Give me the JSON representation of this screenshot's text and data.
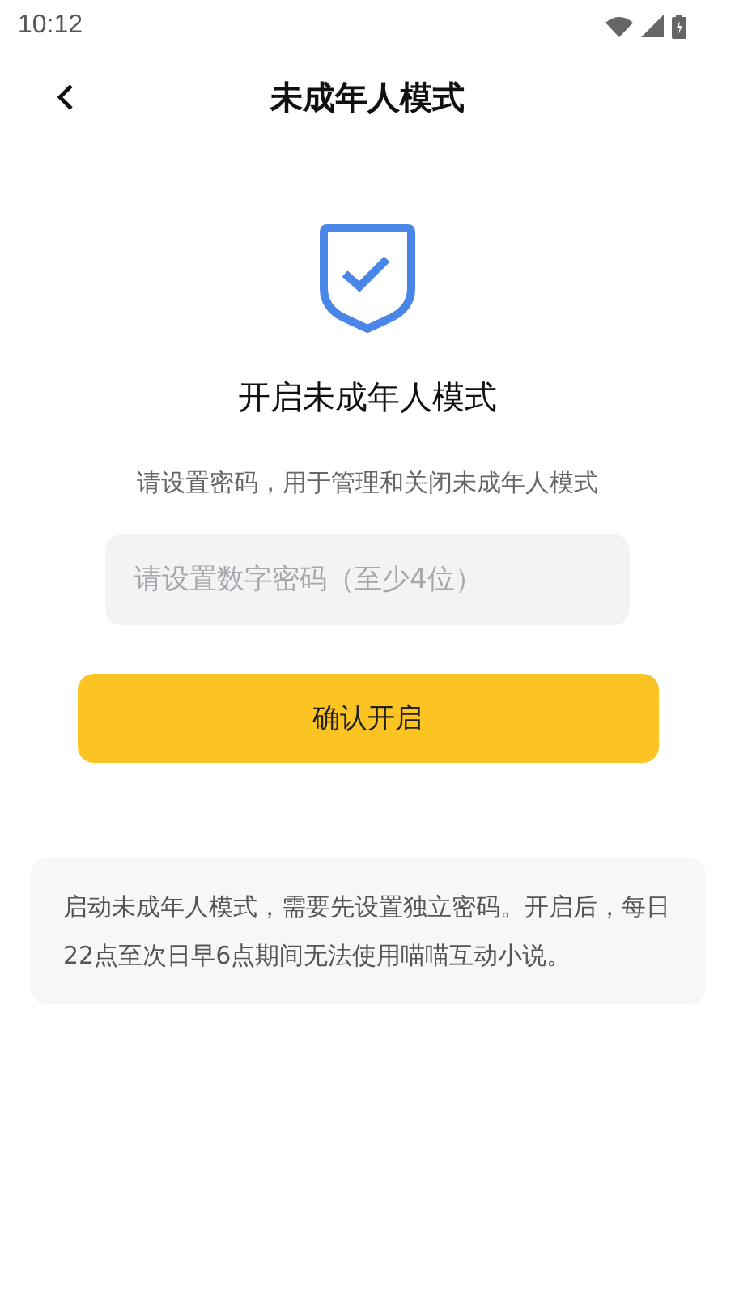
{
  "status_bar": {
    "time": "10:12"
  },
  "header": {
    "title": "未成年人模式"
  },
  "heading": "开启未成年人模式",
  "subtitle": "请设置密码，用于管理和关闭未成年人模式",
  "password_field": {
    "placeholder": "请设置数字密码（至少4位）"
  },
  "confirm_button": "确认开启",
  "notice": "启动未成年人模式，需要先设置独立密码。开启后，每日22点至次日早6点期间无法使用喵喵互动小说。"
}
